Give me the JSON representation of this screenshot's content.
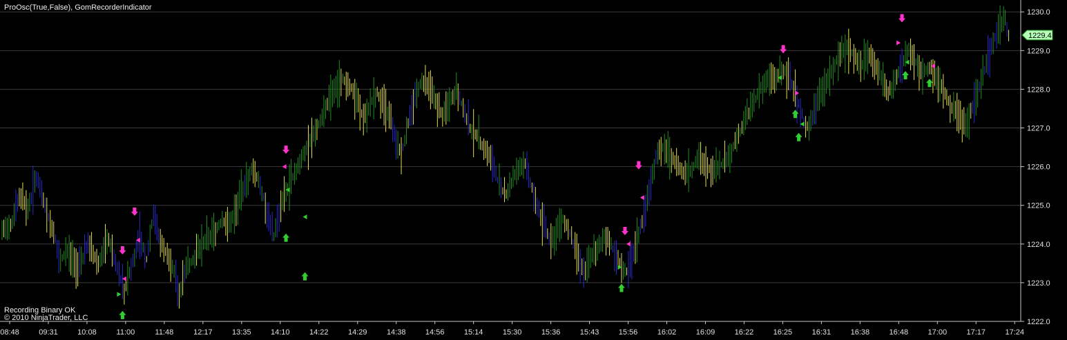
{
  "window": {
    "indicator_label": "ProOsc(True,False), GomRecorderIndicator",
    "status_line1": "Recording Binary OK",
    "status_line2": "© 2010 NinjaTrader, LLC"
  },
  "colors": {
    "background": "#000000",
    "gridline": "#3a3a3a",
    "axis": "#c8c8c8",
    "bar_green": "#1f8f1f",
    "bar_yellow": "#e6e04a",
    "bar_blue": "#2a2ad0",
    "signal_magenta": "#ff33cc",
    "signal_green": "#33cc33",
    "last_price_box": "#1a8f1a"
  },
  "chart_data": {
    "type": "ohlc",
    "title": "",
    "xlabel": "",
    "ylabel": "",
    "ylim": [
      1222.0,
      1230.2
    ],
    "yticks": [
      "1222.0",
      "1223.0",
      "1224.0",
      "1225.0",
      "1226.0",
      "1227.0",
      "1228.0",
      "1229.0",
      "1230.0"
    ],
    "xticks": [
      "08:48",
      "09:31",
      "10:08",
      "11:00",
      "11:48",
      "12:17",
      "13:35",
      "14:10",
      "14:22",
      "14:29",
      "14:38",
      "14:56",
      "15:14",
      "15:30",
      "15:36",
      "15:43",
      "15:56",
      "16:02",
      "16:09",
      "16:22",
      "16:25",
      "16:31",
      "16:38",
      "16:48",
      "17:00",
      "17:17",
      "17:24"
    ],
    "last_price": "1229.4",
    "grid": true,
    "bar_colors_legend": "green = up-move, yellow = down-move, blue = momentum",
    "price_path": [
      [
        0,
        1224.3
      ],
      [
        6,
        1224.6
      ],
      [
        10,
        1225.3
      ],
      [
        15,
        1224.9
      ],
      [
        20,
        1225.7
      ],
      [
        25,
        1225.0
      ],
      [
        30,
        1224.3
      ],
      [
        34,
        1223.6
      ],
      [
        38,
        1223.8
      ],
      [
        44,
        1223.3
      ],
      [
        50,
        1224.0
      ],
      [
        56,
        1223.5
      ],
      [
        62,
        1224.1
      ],
      [
        67,
        1223.4
      ],
      [
        71,
        1222.8
      ],
      [
        75,
        1223.4
      ],
      [
        80,
        1224.2
      ],
      [
        84,
        1223.6
      ],
      [
        88,
        1224.8
      ],
      [
        91,
        1224.2
      ],
      [
        95,
        1223.8
      ],
      [
        100,
        1223.3
      ],
      [
        103,
        1222.7
      ],
      [
        107,
        1223.4
      ],
      [
        111,
        1223.6
      ],
      [
        115,
        1223.9
      ],
      [
        119,
        1224.1
      ],
      [
        123,
        1224.3
      ],
      [
        128,
        1224.6
      ],
      [
        132,
        1224.5
      ],
      [
        137,
        1225.0
      ],
      [
        141,
        1225.5
      ],
      [
        145,
        1225.9
      ],
      [
        149,
        1225.7
      ],
      [
        152,
        1225.2
      ],
      [
        155,
        1224.6
      ],
      [
        158,
        1224.2
      ],
      [
        162,
        1225.0
      ],
      [
        166,
        1225.4
      ],
      [
        170,
        1225.8
      ],
      [
        174,
        1226.2
      ],
      [
        178,
        1226.6
      ],
      [
        182,
        1226.9
      ],
      [
        186,
        1227.3
      ],
      [
        190,
        1227.7
      ],
      [
        194,
        1228.0
      ],
      [
        198,
        1228.3
      ],
      [
        202,
        1228.1
      ],
      [
        206,
        1227.7
      ],
      [
        210,
        1227.3
      ],
      [
        214,
        1227.6
      ],
      [
        218,
        1227.9
      ],
      [
        222,
        1227.5
      ],
      [
        226,
        1227.2
      ],
      [
        229,
        1226.6
      ],
      [
        232,
        1226.3
      ],
      [
        236,
        1227.1
      ],
      [
        240,
        1227.8
      ],
      [
        244,
        1228.2
      ],
      [
        248,
        1228.0
      ],
      [
        252,
        1227.7
      ],
      [
        256,
        1227.3
      ],
      [
        260,
        1227.7
      ],
      [
        264,
        1228.0
      ],
      [
        268,
        1227.5
      ],
      [
        272,
        1227.0
      ],
      [
        276,
        1226.8
      ],
      [
        280,
        1226.5
      ],
      [
        284,
        1226.2
      ],
      [
        287,
        1225.8
      ],
      [
        290,
        1225.4
      ],
      [
        293,
        1225.3
      ],
      [
        296,
        1225.6
      ],
      [
        300,
        1226.0
      ],
      [
        304,
        1226.1
      ],
      [
        307,
        1225.6
      ],
      [
        311,
        1225.0
      ],
      [
        315,
        1224.5
      ],
      [
        319,
        1224.0
      ],
      [
        322,
        1224.3
      ],
      [
        326,
        1224.6
      ],
      [
        329,
        1224.4
      ],
      [
        332,
        1224.0
      ],
      [
        335,
        1223.7
      ],
      [
        338,
        1223.3
      ],
      [
        342,
        1223.6
      ],
      [
        346,
        1223.9
      ],
      [
        350,
        1224.2
      ],
      [
        354,
        1224.0
      ],
      [
        357,
        1223.6
      ],
      [
        360,
        1223.4
      ],
      [
        363,
        1223.3
      ],
      [
        366,
        1223.7
      ],
      [
        369,
        1224.1
      ],
      [
        372,
        1224.6
      ],
      [
        375,
        1225.2
      ],
      [
        378,
        1225.8
      ],
      [
        381,
        1226.4
      ],
      [
        385,
        1226.5
      ],
      [
        389,
        1226.2
      ],
      [
        393,
        1226.0
      ],
      [
        397,
        1225.8
      ],
      [
        401,
        1225.9
      ],
      [
        405,
        1226.3
      ],
      [
        409,
        1226.0
      ],
      [
        413,
        1225.9
      ],
      [
        417,
        1226.0
      ],
      [
        421,
        1226.2
      ],
      [
        425,
        1226.5
      ],
      [
        429,
        1226.9
      ],
      [
        433,
        1227.3
      ],
      [
        437,
        1227.7
      ],
      [
        441,
        1228.0
      ],
      [
        445,
        1228.3
      ],
      [
        449,
        1228.2
      ],
      [
        453,
        1228.5
      ],
      [
        457,
        1228.4
      ],
      [
        460,
        1228.0
      ],
      [
        463,
        1227.6
      ],
      [
        466,
        1227.2
      ],
      [
        469,
        1227.0
      ],
      [
        472,
        1227.4
      ],
      [
        475,
        1227.8
      ],
      [
        479,
        1228.2
      ],
      [
        483,
        1228.6
      ],
      [
        487,
        1228.9
      ],
      [
        491,
        1229.1
      ],
      [
        495,
        1228.9
      ],
      [
        499,
        1228.6
      ],
      [
        503,
        1228.9
      ],
      [
        507,
        1228.7
      ],
      [
        511,
        1228.3
      ],
      [
        515,
        1227.9
      ],
      [
        519,
        1228.2
      ],
      [
        523,
        1228.7
      ],
      [
        527,
        1229.0
      ],
      [
        531,
        1228.7
      ],
      [
        535,
        1228.4
      ],
      [
        539,
        1228.6
      ],
      [
        543,
        1228.3
      ],
      [
        547,
        1228.0
      ],
      [
        551,
        1227.6
      ],
      [
        555,
        1227.4
      ],
      [
        559,
        1227.1
      ],
      [
        563,
        1227.4
      ],
      [
        567,
        1227.9
      ],
      [
        571,
        1228.5
      ],
      [
        575,
        1229.1
      ],
      [
        579,
        1229.6
      ],
      [
        583,
        1229.8
      ],
      [
        585,
        1229.4
      ]
    ],
    "signals": [
      {
        "pos": 70,
        "type": "arrow-up",
        "value": 1222.2
      },
      {
        "pos": 68,
        "type": "triangle-right",
        "value": 1222.7
      },
      {
        "pos": 70,
        "type": "arrow-down",
        "value": 1223.8
      },
      {
        "pos": 71,
        "type": "triangle-left",
        "value": 1223.1
      },
      {
        "pos": 77,
        "type": "arrow-down",
        "value": 1224.8
      },
      {
        "pos": 79,
        "type": "triangle-left",
        "value": 1224.1
      },
      {
        "pos": 165,
        "type": "arrow-down",
        "value": 1226.4
      },
      {
        "pos": 164,
        "type": "triangle-left",
        "value": 1226.0
      },
      {
        "pos": 166,
        "type": "triangle-left",
        "value": 1225.4
      },
      {
        "pos": 165,
        "type": "arrow-up",
        "value": 1224.2
      },
      {
        "pos": 176,
        "type": "triangle-left",
        "value": 1224.7
      },
      {
        "pos": 176,
        "type": "arrow-up",
        "value": 1223.2
      },
      {
        "pos": 362,
        "type": "arrow-down",
        "value": 1224.3
      },
      {
        "pos": 364,
        "type": "triangle-left",
        "value": 1224.0
      },
      {
        "pos": 359,
        "type": "triangle-right",
        "value": 1223.4
      },
      {
        "pos": 360,
        "type": "arrow-up",
        "value": 1222.9
      },
      {
        "pos": 370,
        "type": "arrow-down",
        "value": 1226.0
      },
      {
        "pos": 372,
        "type": "triangle-left",
        "value": 1225.2
      },
      {
        "pos": 454,
        "type": "arrow-down",
        "value": 1229.0
      },
      {
        "pos": 452,
        "type": "triangle-left",
        "value": 1228.3
      },
      {
        "pos": 462,
        "type": "triangle-right",
        "value": 1227.9
      },
      {
        "pos": 461,
        "type": "arrow-up",
        "value": 1227.4
      },
      {
        "pos": 465,
        "type": "triangle-left",
        "value": 1227.1
      },
      {
        "pos": 463,
        "type": "arrow-up",
        "value": 1226.8
      },
      {
        "pos": 523,
        "type": "arrow-down",
        "value": 1229.8
      },
      {
        "pos": 521,
        "type": "triangle-right",
        "value": 1229.2
      },
      {
        "pos": 526,
        "type": "triangle-left",
        "value": 1228.7
      },
      {
        "pos": 525,
        "type": "arrow-up",
        "value": 1228.4
      },
      {
        "pos": 541,
        "type": "triangle-left",
        "value": 1228.6
      },
      {
        "pos": 539,
        "type": "arrow-up",
        "value": 1228.2
      }
    ]
  }
}
